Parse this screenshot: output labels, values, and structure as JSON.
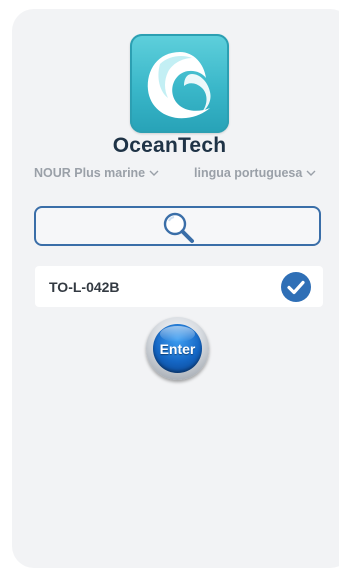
{
  "app": {
    "brand_name": "OceanTech",
    "logo_icon": "ocean-wave-logo"
  },
  "selectors": {
    "vessel": {
      "label": "NOUR Plus marine",
      "icon": "chevron-down-icon"
    },
    "language": {
      "label": "lingua portuguesa",
      "icon": "chevron-down-icon"
    }
  },
  "search": {
    "value": "",
    "placeholder": "",
    "icon": "search-icon"
  },
  "result": {
    "label": "TO-L-042B",
    "selected": true,
    "icon": "check-circle-icon"
  },
  "enter_button": {
    "label": "Enter"
  },
  "colors": {
    "panel_bg": "#f2f3f5",
    "accent_blue": "#3a6ea8",
    "check_blue": "#2f6fb6",
    "logo_teal": "#3ab7c9",
    "brand_text": "#1f3346",
    "muted_text": "#9aa0a8"
  }
}
